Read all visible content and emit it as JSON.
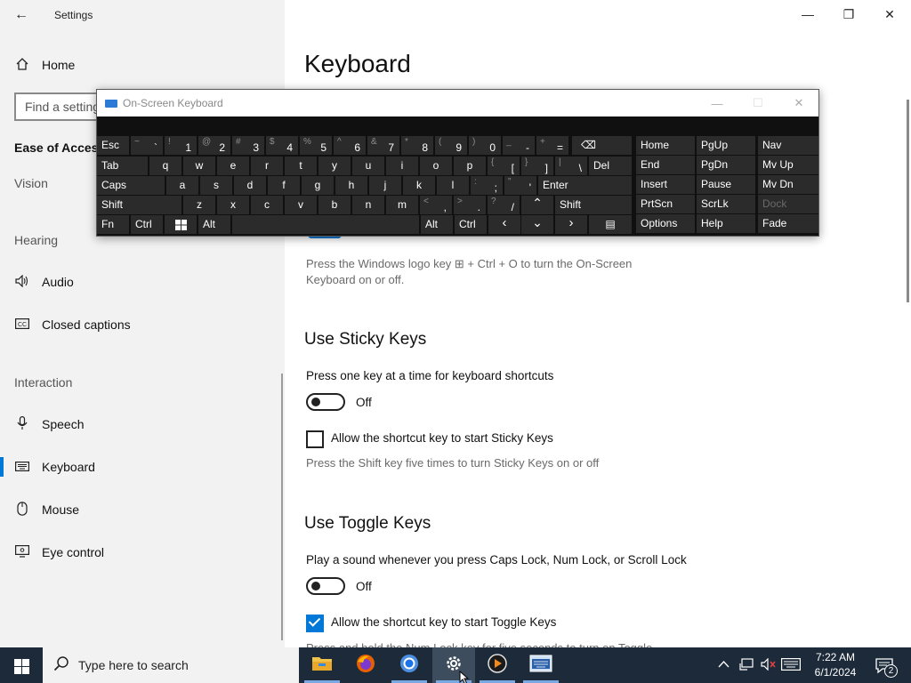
{
  "window": {
    "title": "Settings",
    "back_glyph": "←",
    "minimize_glyph": "—",
    "maximize_glyph": "❐",
    "close_glyph": "✕"
  },
  "sidebar": {
    "home": {
      "label": "Home",
      "icon": "home-icon"
    },
    "search_placeholder": "Find a setting",
    "category": "Ease of Access",
    "vision_label": "Vision",
    "hearing_label": "Hearing",
    "interaction_label": "Interaction",
    "items": [
      {
        "label": "Audio",
        "icon": "speaker-icon"
      },
      {
        "label": "Closed captions",
        "icon": "cc-icon"
      },
      {
        "label": "Speech",
        "icon": "microphone-icon"
      },
      {
        "label": "Keyboard",
        "icon": "keyboard-icon",
        "selected": true
      },
      {
        "label": "Mouse",
        "icon": "mouse-icon"
      },
      {
        "label": "Eye control",
        "icon": "eye-control-icon"
      }
    ]
  },
  "main": {
    "title": "Keyboard",
    "osk_hint": "Press the Windows logo key ⊞ + Ctrl + O to turn the On-Screen Keyboard on or off.",
    "sticky": {
      "heading": "Use Sticky Keys",
      "description": "Press one key at a time for keyboard shortcuts",
      "toggle_state": "Off",
      "checkbox_label": "Allow the shortcut key to start Sticky Keys",
      "checkbox_checked": false,
      "hint": "Press the Shift key five times to turn Sticky Keys on or off"
    },
    "toggle": {
      "heading": "Use Toggle Keys",
      "description": "Play a sound whenever you press Caps Lock, Num Lock, or Scroll Lock",
      "toggle_state": "Off",
      "checkbox_label": "Allow the shortcut key to start Toggle Keys",
      "checkbox_checked": true,
      "hint_partial": "Press and hold the Num Lock key for five seconds to turn on Toggle"
    }
  },
  "osk": {
    "title": "On-Screen Keyboard",
    "min_glyph": "—",
    "max_glyph": "☐",
    "close_glyph": "✕",
    "keys": {
      "esc": "Esc",
      "tab": "Tab",
      "caps": "Caps",
      "shift_l": "Shift",
      "fn": "Fn",
      "ctrl_l": "Ctrl",
      "alt_l": "Alt",
      "win_icon": "windows-icon",
      "row1": [
        {
          "sh": "~",
          "k": "`"
        },
        {
          "sh": "!",
          "k": "1"
        },
        {
          "sh": "@",
          "k": "2"
        },
        {
          "sh": "#",
          "k": "3"
        },
        {
          "sh": "$",
          "k": "4"
        },
        {
          "sh": "%",
          "k": "5"
        },
        {
          "sh": "^",
          "k": "6"
        },
        {
          "sh": "&",
          "k": "7"
        },
        {
          "sh": "*",
          "k": "8"
        },
        {
          "sh": "(",
          "k": "9"
        },
        {
          "sh": ")",
          "k": "0"
        },
        {
          "sh": "_",
          "k": "-"
        },
        {
          "sh": "+",
          "k": "="
        }
      ],
      "backspace": "⌫",
      "row2": [
        "q",
        "w",
        "e",
        "r",
        "t",
        "y",
        "u",
        "i",
        "o",
        "p"
      ],
      "row2_extra": [
        {
          "sh": "{",
          "k": "["
        },
        {
          "sh": "}",
          "k": "]"
        },
        {
          "sh": "|",
          "k": "\\"
        }
      ],
      "del": "Del",
      "row3": [
        "a",
        "s",
        "d",
        "f",
        "g",
        "h",
        "j",
        "k",
        "l"
      ],
      "row3_extra": [
        {
          "sh": ":",
          "k": ";"
        },
        {
          "sh": "\"",
          "k": "'"
        }
      ],
      "enter": "Enter",
      "row4": [
        "z",
        "x",
        "c",
        "v",
        "b",
        "n",
        "m"
      ],
      "row4_extra": [
        {
          "sh": "<",
          "k": ","
        },
        {
          "sh": ">",
          "k": "."
        },
        {
          "sh": "?",
          "k": "/"
        }
      ],
      "up": "⌃",
      "shift_r": "Shift",
      "alt_r": "Alt",
      "ctrl_r": "Ctrl",
      "left": "‹",
      "down": "⌄",
      "right": "›",
      "menu": "▤",
      "nav_col1": [
        "Home",
        "End",
        "Insert",
        "PrtScn",
        "Options"
      ],
      "nav_col2": [
        "PgUp",
        "PgDn",
        "Pause",
        "ScrLk",
        "Help"
      ],
      "nav_col3": [
        "Nav",
        "Mv Up",
        "Mv Dn",
        "Dock",
        "Fade"
      ]
    }
  },
  "taskbar": {
    "search_placeholder": "Type here to search",
    "apps": [
      "file-explorer-icon",
      "firefox-icon",
      "chrome-icon",
      "settings-icon",
      "media-player-icon",
      "on-screen-keyboard-icon"
    ],
    "time": "7:22 AM",
    "date": "6/1/2024",
    "notification_count": "2"
  }
}
